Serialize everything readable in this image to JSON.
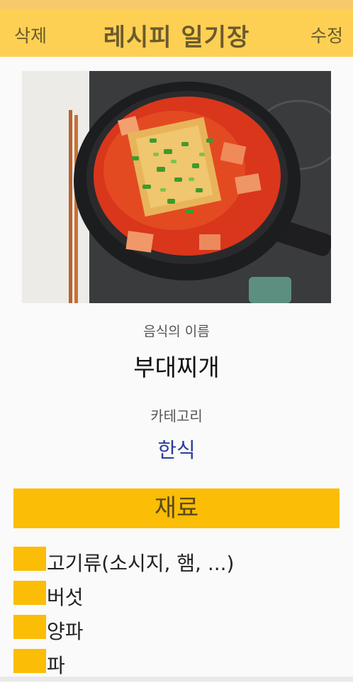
{
  "app_bar": {
    "delete_label": "삭제",
    "title": "레시피 일기장",
    "edit_label": "수정"
  },
  "recipe": {
    "name_label": "음식의 이름",
    "name": "부대찌개",
    "category_label": "카테고리",
    "category": "한식"
  },
  "ingredients": {
    "header": "재료",
    "items": [
      "고기류(소시지, 햄, ...)",
      "버섯",
      "양파",
      "파"
    ]
  },
  "colors": {
    "app_bar": "#fdd054",
    "status_bar": "#f8c96a",
    "accent": "#fbbd05",
    "category_text": "#2e3d9a"
  }
}
